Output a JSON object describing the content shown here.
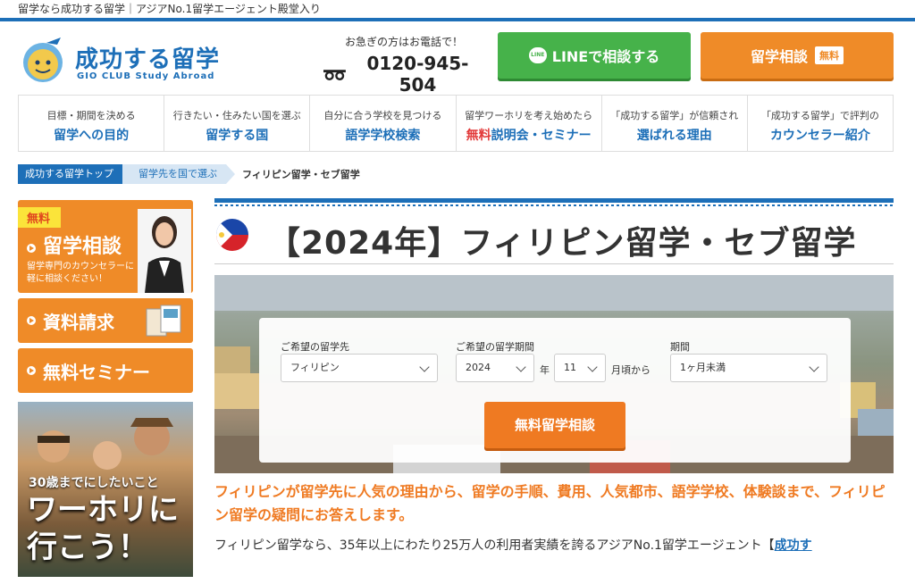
{
  "topbar": {
    "text": "留学なら成功する留学｜アジアNo.1留学エージェント殿堂入り"
  },
  "header": {
    "logo_title": "成功する留学",
    "logo_sub": "GIO CLUB Study Abroad",
    "phone_note": "お急ぎの方はお電話で！",
    "phone_number": "0120-945-504",
    "line_button": "LINEで相談する",
    "consult_button": "留学相談",
    "consult_badge": "無料"
  },
  "nav": [
    {
      "sub": "目標・期間を決める",
      "main": "留学への目的"
    },
    {
      "sub": "行きたい・住みたい国を選ぶ",
      "main": "留学する国"
    },
    {
      "sub": "自分に合う学校を見つける",
      "main": "語学学校検索"
    },
    {
      "sub": "留学ワーホリを考え始めたら",
      "main_red": "無料",
      "main": "説明会・セミナー"
    },
    {
      "sub": "「成功する留学」が信頼され",
      "main": "選ばれる理由"
    },
    {
      "sub": "「成功する留学」で評判の",
      "main": "カウンセラー紹介"
    }
  ],
  "breadcrumb": [
    "成功する留学トップ",
    "留学先を国で選ぶ",
    "フィリピン留学・セブ留学"
  ],
  "sidebar": {
    "consult_free": "無料",
    "consult_title": "留学相談",
    "consult_desc": "留学専門のカウンセラーに お気軽に相談ください！",
    "request": "資料請求",
    "seminar": "無料セミナー",
    "banner_small": "30歳までにしたいこと",
    "banner_big": "ワーホリに 行こう！"
  },
  "main": {
    "title": "【2024年】フィリピン留学・セブ留学",
    "search": {
      "dest_label": "ご希望の留学先",
      "dest_value": "フィリピン",
      "period_label": "ご希望の留学期間",
      "year_value": "2024",
      "year_unit": "年",
      "month_value": "11",
      "month_unit": "月頃から",
      "length_label": "期間",
      "length_value": "1ヶ月未満",
      "submit": "無料留学相談"
    },
    "lead": "フィリピンが留学先に人気の理由から、留学の手順、費用、人気都市、語学学校、体験談まで、フィリピン留学の疑問にお答えします。",
    "body": "フィリピン留学なら、35年以上にわたり25万人の利用者実績を誇るアジアNo.1留学エージェント【",
    "body_link": "成功す"
  },
  "colors": {
    "brand_blue": "#1d6fb8",
    "orange": "#ef8b28",
    "line_green": "#46b24a"
  }
}
